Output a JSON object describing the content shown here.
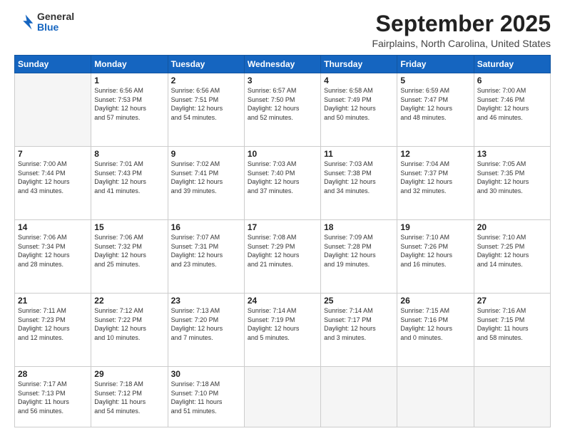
{
  "logo": {
    "general": "General",
    "blue": "Blue"
  },
  "title": "September 2025",
  "subtitle": "Fairplains, North Carolina, United States",
  "days_header": [
    "Sunday",
    "Monday",
    "Tuesday",
    "Wednesday",
    "Thursday",
    "Friday",
    "Saturday"
  ],
  "weeks": [
    [
      {
        "num": "",
        "info": ""
      },
      {
        "num": "1",
        "info": "Sunrise: 6:56 AM\nSunset: 7:53 PM\nDaylight: 12 hours\nand 57 minutes."
      },
      {
        "num": "2",
        "info": "Sunrise: 6:56 AM\nSunset: 7:51 PM\nDaylight: 12 hours\nand 54 minutes."
      },
      {
        "num": "3",
        "info": "Sunrise: 6:57 AM\nSunset: 7:50 PM\nDaylight: 12 hours\nand 52 minutes."
      },
      {
        "num": "4",
        "info": "Sunrise: 6:58 AM\nSunset: 7:49 PM\nDaylight: 12 hours\nand 50 minutes."
      },
      {
        "num": "5",
        "info": "Sunrise: 6:59 AM\nSunset: 7:47 PM\nDaylight: 12 hours\nand 48 minutes."
      },
      {
        "num": "6",
        "info": "Sunrise: 7:00 AM\nSunset: 7:46 PM\nDaylight: 12 hours\nand 46 minutes."
      }
    ],
    [
      {
        "num": "7",
        "info": "Sunrise: 7:00 AM\nSunset: 7:44 PM\nDaylight: 12 hours\nand 43 minutes."
      },
      {
        "num": "8",
        "info": "Sunrise: 7:01 AM\nSunset: 7:43 PM\nDaylight: 12 hours\nand 41 minutes."
      },
      {
        "num": "9",
        "info": "Sunrise: 7:02 AM\nSunset: 7:41 PM\nDaylight: 12 hours\nand 39 minutes."
      },
      {
        "num": "10",
        "info": "Sunrise: 7:03 AM\nSunset: 7:40 PM\nDaylight: 12 hours\nand 37 minutes."
      },
      {
        "num": "11",
        "info": "Sunrise: 7:03 AM\nSunset: 7:38 PM\nDaylight: 12 hours\nand 34 minutes."
      },
      {
        "num": "12",
        "info": "Sunrise: 7:04 AM\nSunset: 7:37 PM\nDaylight: 12 hours\nand 32 minutes."
      },
      {
        "num": "13",
        "info": "Sunrise: 7:05 AM\nSunset: 7:35 PM\nDaylight: 12 hours\nand 30 minutes."
      }
    ],
    [
      {
        "num": "14",
        "info": "Sunrise: 7:06 AM\nSunset: 7:34 PM\nDaylight: 12 hours\nand 28 minutes."
      },
      {
        "num": "15",
        "info": "Sunrise: 7:06 AM\nSunset: 7:32 PM\nDaylight: 12 hours\nand 25 minutes."
      },
      {
        "num": "16",
        "info": "Sunrise: 7:07 AM\nSunset: 7:31 PM\nDaylight: 12 hours\nand 23 minutes."
      },
      {
        "num": "17",
        "info": "Sunrise: 7:08 AM\nSunset: 7:29 PM\nDaylight: 12 hours\nand 21 minutes."
      },
      {
        "num": "18",
        "info": "Sunrise: 7:09 AM\nSunset: 7:28 PM\nDaylight: 12 hours\nand 19 minutes."
      },
      {
        "num": "19",
        "info": "Sunrise: 7:10 AM\nSunset: 7:26 PM\nDaylight: 12 hours\nand 16 minutes."
      },
      {
        "num": "20",
        "info": "Sunrise: 7:10 AM\nSunset: 7:25 PM\nDaylight: 12 hours\nand 14 minutes."
      }
    ],
    [
      {
        "num": "21",
        "info": "Sunrise: 7:11 AM\nSunset: 7:23 PM\nDaylight: 12 hours\nand 12 minutes."
      },
      {
        "num": "22",
        "info": "Sunrise: 7:12 AM\nSunset: 7:22 PM\nDaylight: 12 hours\nand 10 minutes."
      },
      {
        "num": "23",
        "info": "Sunrise: 7:13 AM\nSunset: 7:20 PM\nDaylight: 12 hours\nand 7 minutes."
      },
      {
        "num": "24",
        "info": "Sunrise: 7:14 AM\nSunset: 7:19 PM\nDaylight: 12 hours\nand 5 minutes."
      },
      {
        "num": "25",
        "info": "Sunrise: 7:14 AM\nSunset: 7:17 PM\nDaylight: 12 hours\nand 3 minutes."
      },
      {
        "num": "26",
        "info": "Sunrise: 7:15 AM\nSunset: 7:16 PM\nDaylight: 12 hours\nand 0 minutes."
      },
      {
        "num": "27",
        "info": "Sunrise: 7:16 AM\nSunset: 7:15 PM\nDaylight: 11 hours\nand 58 minutes."
      }
    ],
    [
      {
        "num": "28",
        "info": "Sunrise: 7:17 AM\nSunset: 7:13 PM\nDaylight: 11 hours\nand 56 minutes."
      },
      {
        "num": "29",
        "info": "Sunrise: 7:18 AM\nSunset: 7:12 PM\nDaylight: 11 hours\nand 54 minutes."
      },
      {
        "num": "30",
        "info": "Sunrise: 7:18 AM\nSunset: 7:10 PM\nDaylight: 11 hours\nand 51 minutes."
      },
      {
        "num": "",
        "info": ""
      },
      {
        "num": "",
        "info": ""
      },
      {
        "num": "",
        "info": ""
      },
      {
        "num": "",
        "info": ""
      }
    ]
  ]
}
